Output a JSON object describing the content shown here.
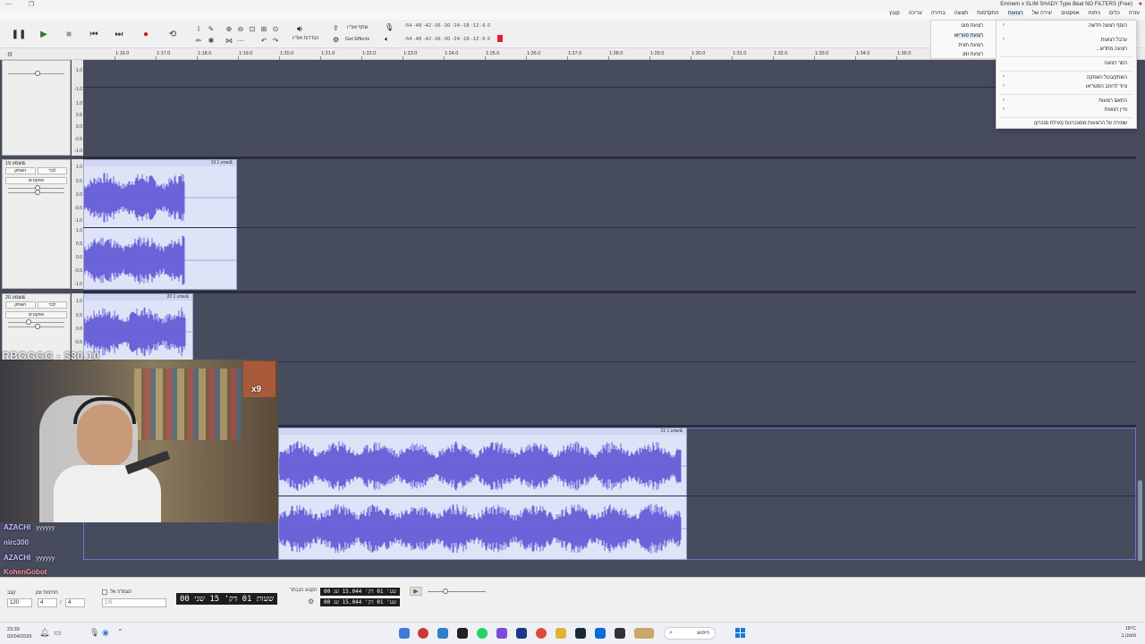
{
  "window": {
    "title": "(Free) Eminem x SLIM SHADY Type Beat  NO FILTERS"
  },
  "menubar": [
    "קובץ",
    "עריכה",
    "בחירה",
    "תצוגה",
    "התקדמות",
    "רצועות",
    "יצירה של",
    "אפקטים",
    "ניתוח",
    "כלים",
    "עזרה"
  ],
  "toolbar": {
    "share_audio": "שתף אודיו",
    "audio_setup": "הגדרות אודיו",
    "get_effects": "Get Effects",
    "meter_scale_play": "-54  -48  -42  -36  -30  -24  -18  -12  -6   0",
    "meter_scale_rec": "-54  -48  -42  -36  -30  -24  -18  -12  -6   0"
  },
  "ruler": {
    "ticks": [
      "1:16.0",
      "1:17.0",
      "1:18.0",
      "1:19.0",
      "1:20.0",
      "1:21.0",
      "1:22.0",
      "1:23.0",
      "1:24.0",
      "1:25.0",
      "1:26.0",
      "1:27.0",
      "1:28.0",
      "1:29.0",
      "1:30.0",
      "1:31.0",
      "1:32.0",
      "1:33.0",
      "1:34.0",
      "1:35.0"
    ]
  },
  "tracks": {
    "scale": [
      "1.0",
      "0.5",
      "0.0",
      "-0.5",
      "-1.0"
    ],
    "track19": {
      "name": "שמע 19&",
      "mute": "השתק",
      "solo": "לבד",
      "effects": "אפקטים",
      "clip": "שמע 1 19&"
    },
    "track20": {
      "name": "שמע 20&",
      "mute": "השתק",
      "solo": "לבד",
      "effects": "אפקטים",
      "clip": "שמע 1 20&"
    },
    "track21": {
      "clip": "שמע 1 21&"
    }
  },
  "menu": {
    "items": [
      "הוסף רצועה חדשה",
      "ערבל רצועות",
      "רצועה מחדש...",
      "הסר רצועה",
      "השתק/בטל השתקה",
      "ציוד לרוחב הסטריאו",
      "התאם רצועות",
      "מיין רצועות",
      "שמירה על הרצועות מסונכרנות (נעילת סנכרון)"
    ],
    "submenu": [
      "רצועת מונו",
      "רצועת סטריאו",
      "רצועת תווית",
      "רצועת זמן"
    ]
  },
  "stream": {
    "overlay": "RBGGGG - $30.10",
    "badge": "x9",
    "chat": [
      {
        "user": "AZACHI",
        "msg": "yyyyyy"
      },
      {
        "user": "nirc300",
        "msg": ""
      },
      {
        "user": "AZACHI",
        "msg": "yyyyyy"
      },
      {
        "user": "KohenGobot",
        "msg": ""
      }
    ]
  },
  "bottom": {
    "tempo_label": "קצב",
    "tempo_value": "120",
    "sig_label": "חתימת זמן",
    "sig_num": "4",
    "sig_den": "4",
    "snap_label": "הצמדה אל",
    "snap_value": "1/8",
    "time_display": "00 שעות 01 דק' 15 שני",
    "sel_label": "הקטע הנבחר",
    "sel_start": "00 שע' 01 דק' 15.044 שנ",
    "sel_end": "00 שע' 01 דק' 15.044 שנ"
  },
  "taskbar": {
    "time": "23:39",
    "date": "02/04/2026",
    "search": "חיפוש",
    "weather": "18°C",
    "weather_desc": "מעונן ב"
  }
}
